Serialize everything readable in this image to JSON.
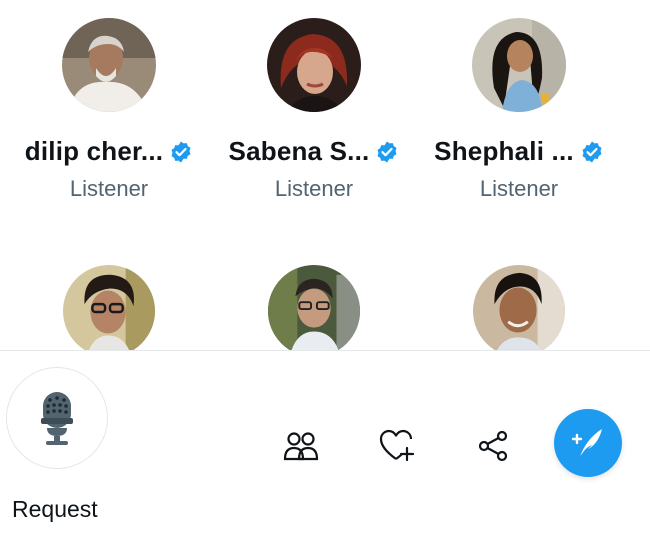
{
  "listeners": [
    {
      "name": "dilip cher...",
      "role": "Listener",
      "verified": true
    },
    {
      "name": "Sabena S...",
      "role": "Listener",
      "verified": true
    },
    {
      "name": "Shephali ...",
      "role": "Listener",
      "verified": true
    },
    {
      "name": "",
      "role": "",
      "verified": false
    },
    {
      "name": "",
      "role": "",
      "verified": false
    },
    {
      "name": "",
      "role": "",
      "verified": false
    }
  ],
  "toolbar": {
    "request_label": "Request",
    "icons": {
      "mic": "microphone-icon",
      "people": "people-icon",
      "heart": "heart-plus-icon",
      "share": "share-icon",
      "compose": "compose-feather-icon"
    }
  },
  "colors": {
    "accent": "#1d9bf0",
    "verified": "#1d9bf0",
    "secondary_text": "#536471"
  }
}
